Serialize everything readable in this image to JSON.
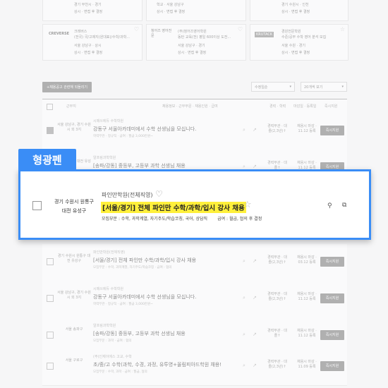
{
  "top_cards": [
    {
      "line1": "경기 부천시 · 경기",
      "line2": "상시 · 면접 후 결정"
    },
    {
      "line1": "학교 · 서울 강남구",
      "line2": "상시 · 면접 후 결정"
    },
    {
      "line1": "경기 수원시 · 인천",
      "line2": "상시 · 면접 후 결정"
    }
  ],
  "company_cards": [
    {
      "logo": "CREVERSE",
      "name": "크레버스",
      "title": "(전국) 국/고제지(원대표)/수학/과학...",
      "meta": "서울 강남구 · 상시",
      "deadline": "상시 · 면접 후 결정"
    },
    {
      "logo": "청어즈 영어전문",
      "name": "(주)청어즈영어학원",
      "title": "동탄 교육(전) 평일 600이상 도전...",
      "meta": "서울 강남구 · 경기",
      "deadline": "상시 · 면접 후 결정"
    },
    {
      "logo": "KRUTACK",
      "name": "경원전문학원",
      "title": "수준/공부 수학 영어 분석 모집",
      "meta": "서울 수원 · 경기",
      "deadline": "상시 · 면접 후 결정"
    }
  ],
  "toolbar": {
    "button": "+채용공고 관련해 되돌리기",
    "sort": "수정일순",
    "per_page": "20개씩 보기"
  },
  "table_head": {
    "loc": "근무지",
    "info": "채용정보 · 근무부문 · 채용인원 · 급여",
    "career": "경력 · 학력",
    "deadline": "마감일 · 등록일",
    "apply": "즉시지원"
  },
  "rows": [
    {
      "loc": "서울 강남구, 경기 수원시 외 3지",
      "co": "시매쓰에듀 수학학원",
      "ttl": "강동구 서울아카데미에서 수학 선생님을 모십니다.",
      "sub": "학력무관 · 정규직 · 급여 : 월급 3,000만원~",
      "car": "경력무관 · 대졸(2,3년)↑",
      "dl": "채용시 마감 · 11.12 등록",
      "apply": "즉시지원",
      "checked": true
    },
    {
      "loc": "서울 송파구, 대전 유성구",
      "co": "알프링과학학원",
      "ttl": "[송파/강동] 중등부, 고등부 과학 선생님 채용",
      "sub": "모집부문 : 과학 · 급여 : 협의",
      "car": "경력무관 · 대졸↑",
      "dl": "채용시 마감 · 11.12 등록",
      "apply": "즉시지원",
      "checked": false
    }
  ],
  "highlight": {
    "tag": "형광펜",
    "loc_line1": "경기 수원시 원통구",
    "loc_line2": "대전 유성구",
    "company": "파인만학원(전체직영)",
    "title": "[서울/경기] 전체 파인만 수학/과학/입시 강사 채용",
    "meta_dept": "모집부문 : 수학, 과학계열, 자기주도/학습코칭, 국어, 상담직",
    "meta_pay": "급여 : 월급, 협의 후 결정"
  },
  "rows_after": [
    {
      "loc": "경기 수원시 원통구 대전 유성구",
      "co": "파인만학원(전체직영)",
      "ttl": "[서울/경기] 전체 파인만 수학/과학/입시 강사 채용",
      "sub": "모집부문 : 수학, 과학계열, 자기주도/학습코칭 · 급여 : 협의",
      "car": "경력무관 · 대졸(2,3년)↑",
      "dl": "채용시 마감 · 03.12 등록",
      "apply": "즉시지원",
      "checked": false
    },
    {
      "loc": "서울 강남구, 경기 수원시 외 3지",
      "co": "시매쓰에듀 수학학원",
      "ttl": "강동구 서울아카데미에서 수학 선생님을 모십니다.",
      "sub": "학력무관 · 정규직 · 급여 : 월급 3,000만원~",
      "car": "경력무관 · 대졸(2,3년)↑",
      "dl": "채용시 마감 · 11.12 등록",
      "apply": "즉시지원",
      "checked": false
    },
    {
      "loc": "서울 송파구",
      "co": "알프링과학학원",
      "ttl": "[송파/강동] 중등부, 고등부 과학 선생님 채용",
      "sub": "모집부문 : 과학 · 급여 : 협의",
      "car": "경력무관 · 대졸↑",
      "dl": "채용시 마감 · 11.12 등록",
      "apply": "즉시지원",
      "checked": false
    },
    {
      "loc": "서울 구로구",
      "co": "(주)인제이에스 고교, 수학",
      "ttl": "초/중/고 수학(과학, 수경, 과정, 유투영+올림피아드학원 채용!",
      "sub": "모집부문 : 수학, 과학 · 급여 : 월급, 협의",
      "car": "경력무관 · 대졸(2,3년)↑",
      "dl": "채용시 마감 · 11.09 등록",
      "apply": "즉시지원",
      "checked": false
    }
  ]
}
